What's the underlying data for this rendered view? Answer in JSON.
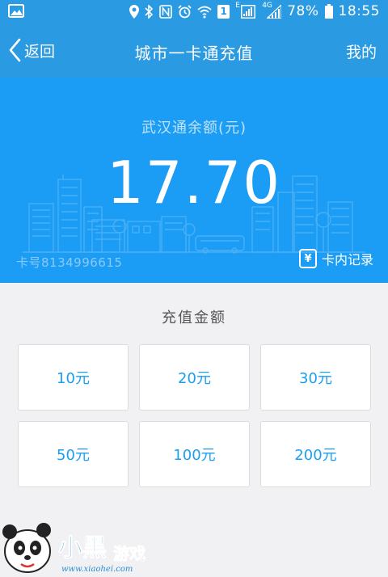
{
  "status_bar": {
    "battery": "78%",
    "time": "18:55",
    "sim_badge": "1",
    "network_e": "E",
    "network_4g": "4G"
  },
  "nav": {
    "back_label": "返回",
    "title": "城市一卡通充值",
    "right_label": "我的"
  },
  "card": {
    "balance_label": "武汉通余额(元)",
    "balance_value": "17.70",
    "card_number": "卡号8134996615",
    "records_label": "卡内记录",
    "records_icon_glyph": "¥"
  },
  "recharge": {
    "section_title": "充值金额",
    "options": [
      "10元",
      "20元",
      "30元",
      "50元",
      "100元",
      "200元"
    ]
  },
  "watermark": {
    "brand": "小黑游戏",
    "url": "www.xiaohei.com"
  },
  "colors": {
    "header_blue": "#2a9ae3",
    "card_blue": "#1b9cf5",
    "accent_text": "#1a9ff0",
    "background": "#f1f1f3"
  }
}
